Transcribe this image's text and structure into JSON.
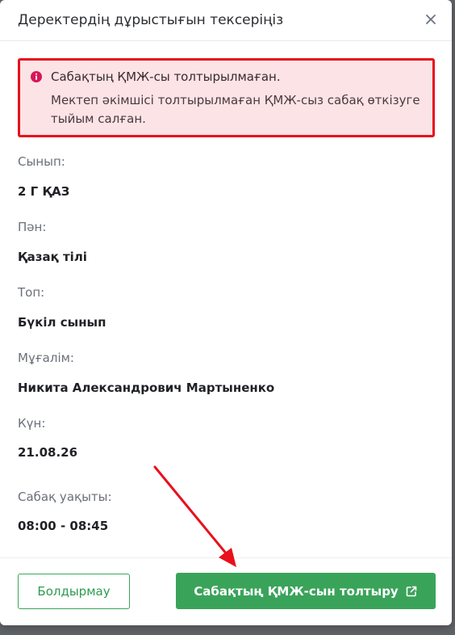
{
  "modal": {
    "title": "Деректердің дұрыстығын тексеріңіз",
    "close_icon": "close-icon"
  },
  "alert": {
    "icon": "info-circle-icon",
    "title": "Сабақтың ҚМЖ-сы толтырылмаған.",
    "text": "Мектеп әкімшісі толтырылмаған ҚМЖ-сыз сабақ өткізуге тыйым салған.",
    "color": "#e8101c",
    "background": "#fbe3e6"
  },
  "fields": [
    {
      "label": "Сынып:",
      "value": "2 Г ҚАЗ"
    },
    {
      "label": "Пән:",
      "value": "Қазақ тілі"
    },
    {
      "label": "Топ:",
      "value": "Бүкіл сынып"
    },
    {
      "label": "Мұғалім:",
      "value": "Никита Александрович Мартыненко"
    },
    {
      "label": "Күн:",
      "value": "21.08.26"
    },
    {
      "label": "Сабақ уақыты:",
      "value": "08:00 - 08:45"
    }
  ],
  "footer": {
    "cancel_label": "Болдырмау",
    "primary_label": "Сабақтың ҚМЖ-сын толтыру",
    "primary_icon": "external-link-icon",
    "accent": "#3aa35a"
  },
  "annotation": {
    "arrow_color": "#e8101c"
  }
}
